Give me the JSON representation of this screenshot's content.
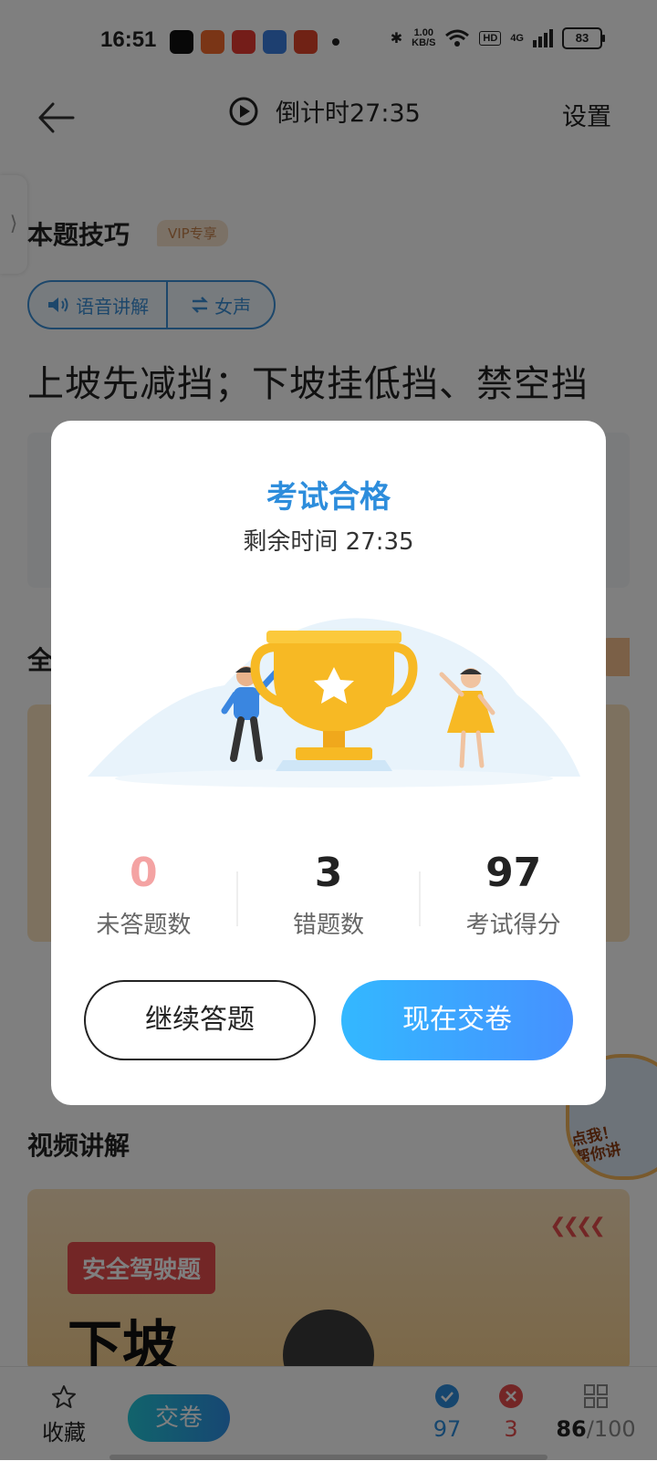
{
  "status_bar": {
    "time": "16:51",
    "network_speed_value": "1.00",
    "network_speed_unit": "KB/S",
    "hd": "HD",
    "signal": "4G",
    "battery": "83"
  },
  "header": {
    "countdown": "倒计时27:35",
    "settings": "设置"
  },
  "background": {
    "side_tab": "⟩",
    "skill_title": "本题技巧",
    "vip_badge": "VIP专享",
    "voice_btn": "语音讲解",
    "voice_switch": "女声",
    "tip": "上坡先减挡；下坡挂低挡、禁空挡",
    "section_all": "全",
    "video_title": "视频讲解",
    "banner_tag": "安全驾驶题",
    "banner_big": "下坡",
    "teacher_label_1": "点我！",
    "teacher_label_2": "帮你讲"
  },
  "bottom_bar": {
    "favorite": "收藏",
    "submit": "交卷",
    "correct_count": "97",
    "wrong_count": "3",
    "progress_current": "86",
    "progress_total": "/100"
  },
  "dialog": {
    "title": "考试合格",
    "remaining": "剩余时间 27:35",
    "stats": [
      {
        "value": "0",
        "label": "未答题数"
      },
      {
        "value": "3",
        "label": "错题数"
      },
      {
        "value": "97",
        "label": "考试得分"
      }
    ],
    "continue_button": "继续答题",
    "submit_button": "现在交卷"
  },
  "colors": {
    "accent_blue": "#2d8ddc",
    "unanswered_pink": "#f4a3a3",
    "submit_gradient_start": "#33b8ff",
    "submit_gradient_end": "#4691ff",
    "trophy_gold": "#f7b924"
  },
  "icons": [
    "back-arrow-icon",
    "play-circle-icon",
    "speaker-icon",
    "swap-icon",
    "star-icon",
    "check-icon",
    "x-icon",
    "grid-icon",
    "trophy-icon",
    "play-icon"
  ]
}
